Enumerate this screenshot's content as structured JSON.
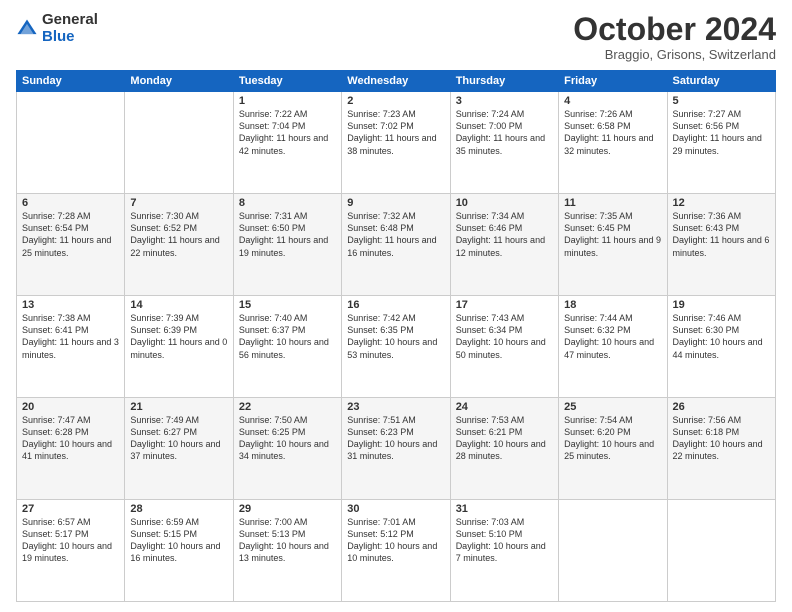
{
  "header": {
    "logo_general": "General",
    "logo_blue": "Blue",
    "month_title": "October 2024",
    "subtitle": "Braggio, Grisons, Switzerland"
  },
  "days_of_week": [
    "Sunday",
    "Monday",
    "Tuesday",
    "Wednesday",
    "Thursday",
    "Friday",
    "Saturday"
  ],
  "weeks": [
    [
      {
        "day": "",
        "info": ""
      },
      {
        "day": "",
        "info": ""
      },
      {
        "day": "1",
        "info": "Sunrise: 7:22 AM\nSunset: 7:04 PM\nDaylight: 11 hours and 42 minutes."
      },
      {
        "day": "2",
        "info": "Sunrise: 7:23 AM\nSunset: 7:02 PM\nDaylight: 11 hours and 38 minutes."
      },
      {
        "day": "3",
        "info": "Sunrise: 7:24 AM\nSunset: 7:00 PM\nDaylight: 11 hours and 35 minutes."
      },
      {
        "day": "4",
        "info": "Sunrise: 7:26 AM\nSunset: 6:58 PM\nDaylight: 11 hours and 32 minutes."
      },
      {
        "day": "5",
        "info": "Sunrise: 7:27 AM\nSunset: 6:56 PM\nDaylight: 11 hours and 29 minutes."
      }
    ],
    [
      {
        "day": "6",
        "info": "Sunrise: 7:28 AM\nSunset: 6:54 PM\nDaylight: 11 hours and 25 minutes."
      },
      {
        "day": "7",
        "info": "Sunrise: 7:30 AM\nSunset: 6:52 PM\nDaylight: 11 hours and 22 minutes."
      },
      {
        "day": "8",
        "info": "Sunrise: 7:31 AM\nSunset: 6:50 PM\nDaylight: 11 hours and 19 minutes."
      },
      {
        "day": "9",
        "info": "Sunrise: 7:32 AM\nSunset: 6:48 PM\nDaylight: 11 hours and 16 minutes."
      },
      {
        "day": "10",
        "info": "Sunrise: 7:34 AM\nSunset: 6:46 PM\nDaylight: 11 hours and 12 minutes."
      },
      {
        "day": "11",
        "info": "Sunrise: 7:35 AM\nSunset: 6:45 PM\nDaylight: 11 hours and 9 minutes."
      },
      {
        "day": "12",
        "info": "Sunrise: 7:36 AM\nSunset: 6:43 PM\nDaylight: 11 hours and 6 minutes."
      }
    ],
    [
      {
        "day": "13",
        "info": "Sunrise: 7:38 AM\nSunset: 6:41 PM\nDaylight: 11 hours and 3 minutes."
      },
      {
        "day": "14",
        "info": "Sunrise: 7:39 AM\nSunset: 6:39 PM\nDaylight: 11 hours and 0 minutes."
      },
      {
        "day": "15",
        "info": "Sunrise: 7:40 AM\nSunset: 6:37 PM\nDaylight: 10 hours and 56 minutes."
      },
      {
        "day": "16",
        "info": "Sunrise: 7:42 AM\nSunset: 6:35 PM\nDaylight: 10 hours and 53 minutes."
      },
      {
        "day": "17",
        "info": "Sunrise: 7:43 AM\nSunset: 6:34 PM\nDaylight: 10 hours and 50 minutes."
      },
      {
        "day": "18",
        "info": "Sunrise: 7:44 AM\nSunset: 6:32 PM\nDaylight: 10 hours and 47 minutes."
      },
      {
        "day": "19",
        "info": "Sunrise: 7:46 AM\nSunset: 6:30 PM\nDaylight: 10 hours and 44 minutes."
      }
    ],
    [
      {
        "day": "20",
        "info": "Sunrise: 7:47 AM\nSunset: 6:28 PM\nDaylight: 10 hours and 41 minutes."
      },
      {
        "day": "21",
        "info": "Sunrise: 7:49 AM\nSunset: 6:27 PM\nDaylight: 10 hours and 37 minutes."
      },
      {
        "day": "22",
        "info": "Sunrise: 7:50 AM\nSunset: 6:25 PM\nDaylight: 10 hours and 34 minutes."
      },
      {
        "day": "23",
        "info": "Sunrise: 7:51 AM\nSunset: 6:23 PM\nDaylight: 10 hours and 31 minutes."
      },
      {
        "day": "24",
        "info": "Sunrise: 7:53 AM\nSunset: 6:21 PM\nDaylight: 10 hours and 28 minutes."
      },
      {
        "day": "25",
        "info": "Sunrise: 7:54 AM\nSunset: 6:20 PM\nDaylight: 10 hours and 25 minutes."
      },
      {
        "day": "26",
        "info": "Sunrise: 7:56 AM\nSunset: 6:18 PM\nDaylight: 10 hours and 22 minutes."
      }
    ],
    [
      {
        "day": "27",
        "info": "Sunrise: 6:57 AM\nSunset: 5:17 PM\nDaylight: 10 hours and 19 minutes."
      },
      {
        "day": "28",
        "info": "Sunrise: 6:59 AM\nSunset: 5:15 PM\nDaylight: 10 hours and 16 minutes."
      },
      {
        "day": "29",
        "info": "Sunrise: 7:00 AM\nSunset: 5:13 PM\nDaylight: 10 hours and 13 minutes."
      },
      {
        "day": "30",
        "info": "Sunrise: 7:01 AM\nSunset: 5:12 PM\nDaylight: 10 hours and 10 minutes."
      },
      {
        "day": "31",
        "info": "Sunrise: 7:03 AM\nSunset: 5:10 PM\nDaylight: 10 hours and 7 minutes."
      },
      {
        "day": "",
        "info": ""
      },
      {
        "day": "",
        "info": ""
      }
    ]
  ]
}
